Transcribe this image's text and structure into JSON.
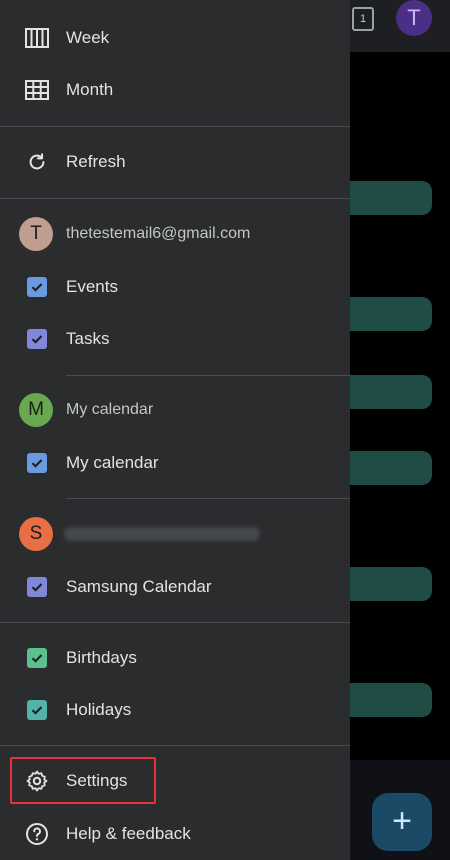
{
  "background": {
    "today_badge": "1",
    "avatar_letter": "T",
    "fab_symbol": "+"
  },
  "drawer": {
    "views": [
      {
        "label": "Week",
        "icon": "week-view-icon"
      },
      {
        "label": "Month",
        "icon": "month-view-icon"
      }
    ],
    "refresh": {
      "label": "Refresh",
      "icon": "refresh-icon"
    },
    "accounts": [
      {
        "avatar_letter": "T",
        "avatar_color": "#c09d8e",
        "email": "thetestemail6@gmail.com",
        "calendars": [
          {
            "label": "Events",
            "color": "#6a9be0",
            "checked": true
          },
          {
            "label": "Tasks",
            "color": "#8187d9",
            "checked": true
          }
        ]
      },
      {
        "avatar_letter": "M",
        "avatar_color": "#6aa84f",
        "name": "My calendar",
        "calendars": [
          {
            "label": "My calendar",
            "color": "#6a9be0",
            "checked": true
          }
        ]
      },
      {
        "avatar_letter": "S",
        "avatar_color": "#e86e43",
        "calendars": [
          {
            "label": "Samsung Calendar",
            "color": "#8187d9",
            "checked": true
          }
        ]
      }
    ],
    "other_calendars": [
      {
        "label": "Birthdays",
        "color": "#5cbf8e",
        "checked": true
      },
      {
        "label": "Holidays",
        "color": "#52b3a8",
        "checked": true
      }
    ],
    "settings": {
      "label": "Settings",
      "icon": "gear-icon"
    },
    "help": {
      "label": "Help & feedback",
      "icon": "help-icon"
    },
    "highlight_color": "#e8323c"
  }
}
